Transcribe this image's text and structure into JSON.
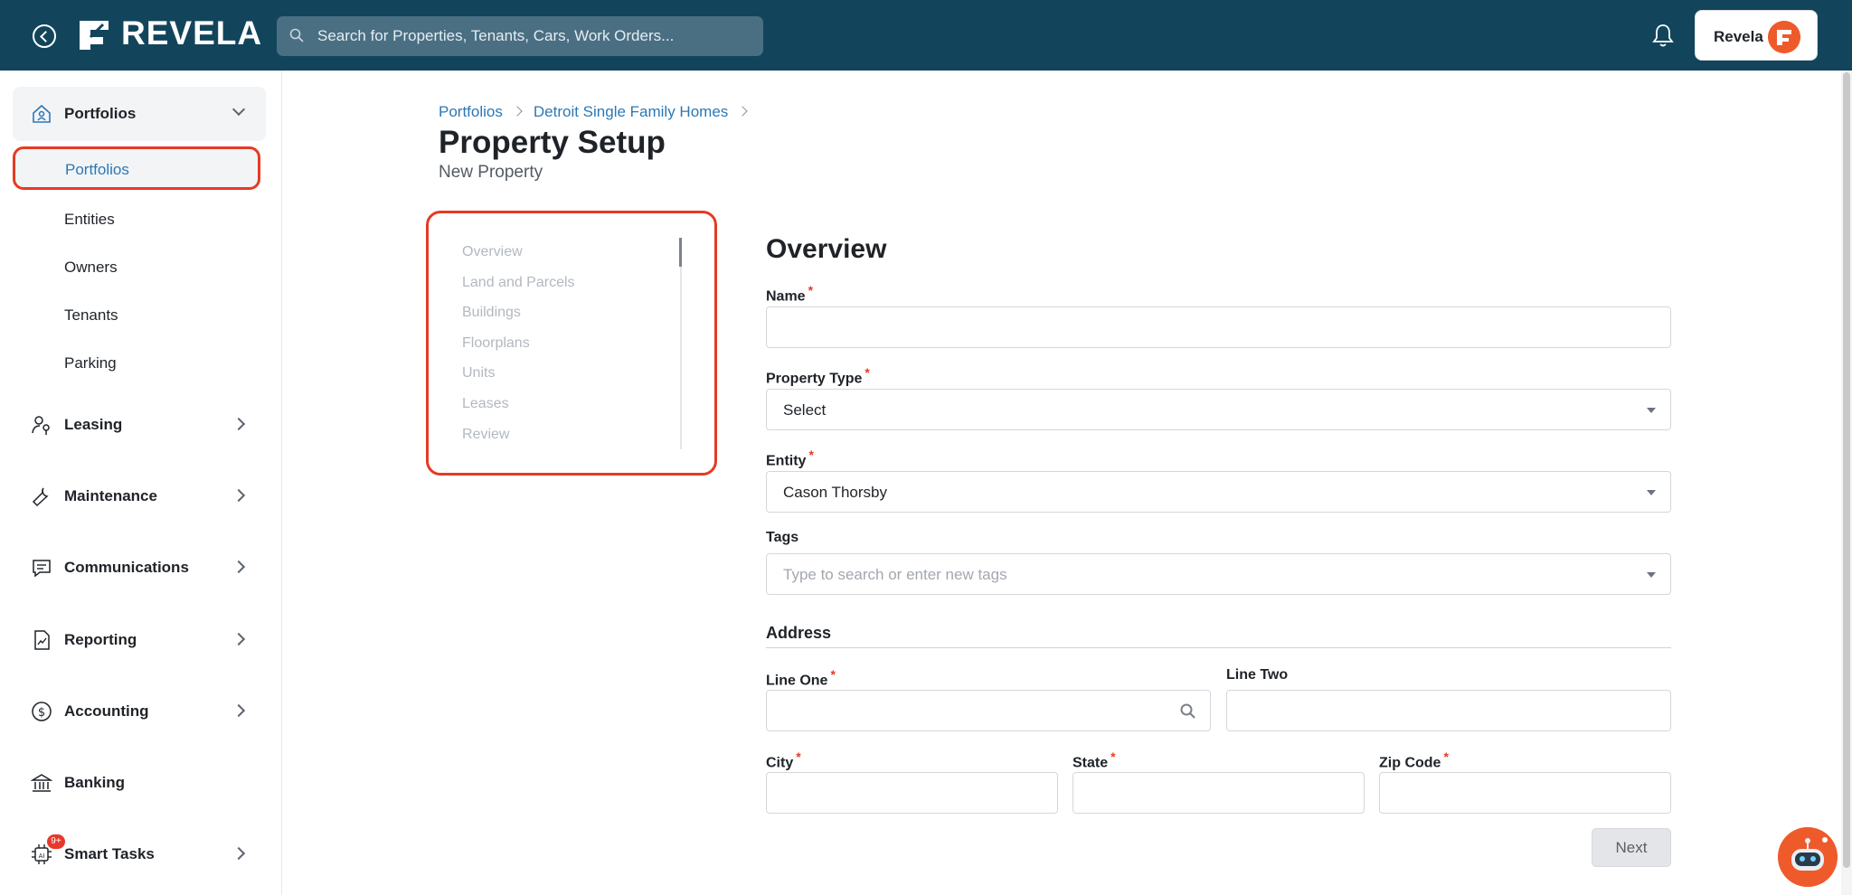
{
  "header": {
    "logo_text": "REVELA",
    "search_placeholder": "Search for Properties, Tenants, Cars, Work Orders...",
    "user_name": "Revela",
    "brand_color": "#12455b",
    "accent_color": "#ef5a2b"
  },
  "sidebar": {
    "portfolios_group": "Portfolios",
    "sub_items": [
      "Portfolios",
      "Entities",
      "Owners",
      "Tenants",
      "Parking"
    ],
    "groups": [
      "Leasing",
      "Maintenance",
      "Communications",
      "Reporting",
      "Accounting",
      "Banking",
      "Smart Tasks"
    ],
    "smart_tasks_badge": "9+"
  },
  "breadcrumb": [
    "Portfolios",
    "Detroit Single Family Homes"
  ],
  "page": {
    "title": "Property Setup",
    "subtitle": "New Property"
  },
  "steps": [
    "Overview",
    "Land and Parcels",
    "Buildings",
    "Floorplans",
    "Units",
    "Leases",
    "Review"
  ],
  "form": {
    "section_title": "Overview",
    "name_label": "Name",
    "property_type_label": "Property Type",
    "property_type_value": "Select",
    "entity_label": "Entity",
    "entity_value": "Cason Thorsby",
    "tags_label": "Tags",
    "tags_placeholder": "Type to search or enter new tags",
    "address_title": "Address",
    "line_one_label": "Line One",
    "line_two_label": "Line Two",
    "city_label": "City",
    "state_label": "State",
    "zip_label": "Zip Code",
    "required_mark": "*",
    "next_label": "Next"
  }
}
